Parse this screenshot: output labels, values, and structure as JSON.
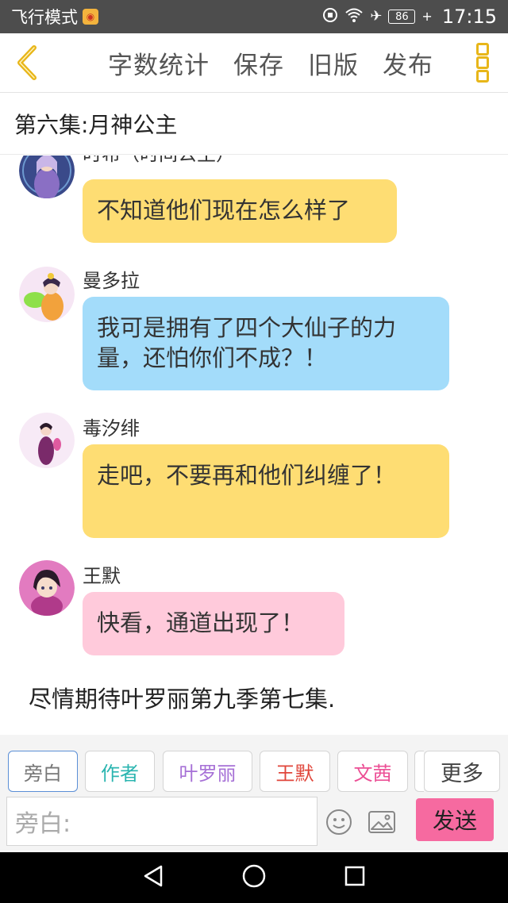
{
  "status_bar": {
    "carrier": "飞行模式",
    "battery": "86",
    "time": "17:15"
  },
  "toolbar": {
    "word_count": "字数统计",
    "save": "保存",
    "old_version": "旧版",
    "publish": "发布"
  },
  "episode_title": "第六集:月神公主",
  "messages": [
    {
      "sender": "时希（时间公主）",
      "text": "不知道他们现在怎么样了",
      "color": "#fedd73"
    },
    {
      "sender": "曼多拉",
      "text": "我可是拥有了四个大仙子的力量，还怕你们不成？！",
      "color": "#a3dcfa"
    },
    {
      "sender": "毒汐绯",
      "text": "走吧，不要再和他们纠缠了！",
      "color": "#fedd73"
    },
    {
      "sender": "王默",
      "text": "快看，通道出现了！",
      "color": "#ffcadb"
    }
  ],
  "narration": "尽情期待叶罗丽第九季第七集.",
  "roles": [
    {
      "label": "旁白",
      "color": "#777777"
    },
    {
      "label": "作者",
      "color": "#2bb5b0"
    },
    {
      "label": "叶罗丽",
      "color": "#a670d6"
    },
    {
      "label": "王默",
      "color": "#e0453a"
    },
    {
      "label": "文茜",
      "color": "#ec4f95"
    },
    {
      "label": "更多",
      "color": "#444444"
    }
  ],
  "input": {
    "placeholder": "旁白:"
  },
  "send_label": "发送",
  "colors": {
    "accent": "#e8b619",
    "send": "#f66aa0",
    "status_bar": "#4d4d4d"
  }
}
